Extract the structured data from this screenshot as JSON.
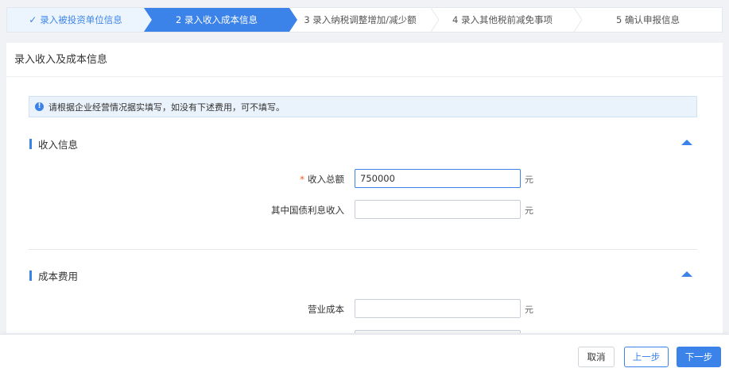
{
  "steps": [
    {
      "label": "录入被投资单位信息",
      "state": "done",
      "icon": "check-icon"
    },
    {
      "label": "2 录入收入成本信息",
      "state": "active"
    },
    {
      "label": "3 录入纳税调整增加/减少额",
      "state": "todo"
    },
    {
      "label": "4 录入其他税前减免事项",
      "state": "todo"
    },
    {
      "label": "5 确认申报信息",
      "state": "todo"
    }
  ],
  "card": {
    "title": "录入收入及成本信息",
    "notice": "请根据企业经营情况据实填写，如没有下述费用，可不填写。",
    "notice_icon": "info-icon"
  },
  "income": {
    "title": "收入信息",
    "total_label": "收入总额",
    "total_required_mark": "*",
    "total_value": "750000",
    "total_unit": "元",
    "bond_label": "其中国债利息收入",
    "bond_value": "",
    "bond_unit": "元"
  },
  "cost": {
    "title": "成本费用",
    "op_cost_label": "营业成本",
    "op_cost_value": "",
    "op_cost_unit": "元"
  },
  "footer": {
    "cancel_label": "取消",
    "prev_label": "上一步",
    "next_label": "下一步"
  },
  "colors": {
    "accent": "#3b83e9",
    "required": "#f05a1a"
  }
}
